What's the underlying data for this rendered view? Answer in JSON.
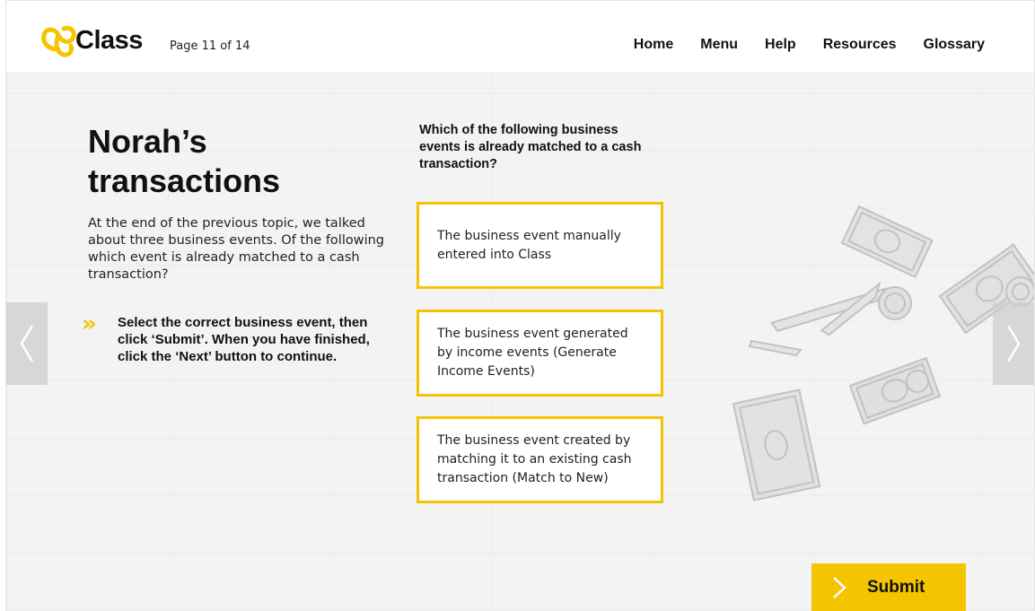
{
  "header": {
    "logo_text": "Class",
    "page_indicator": "Page 11 of 14",
    "nav": [
      "Home",
      "Menu",
      "Help",
      "Resources",
      "Glossary"
    ]
  },
  "main": {
    "title": "Norah’s transactions",
    "intro": "At the end of the previous topic, we talked about three business events. Of the following which event is already matched to a cash transaction?",
    "instruction": "Select the correct business event, then click ‘Submit’. When you have finished, click the ‘Next’ button to continue.",
    "question": "Which of the following business events is already matched to a cash transaction?",
    "options": [
      "The business event manually entered into Class",
      "The business event generated by income events (Generate Income Events)",
      "The business event created by matching it to an existing cash transaction (Match to New)"
    ]
  },
  "controls": {
    "submit_label": "Submit",
    "prev_icon": "chevron-left-icon",
    "next_icon": "chevron-right-icon"
  },
  "colors": {
    "accent": "#f5c400",
    "text": "#111111",
    "background": "#f3f3f3"
  }
}
